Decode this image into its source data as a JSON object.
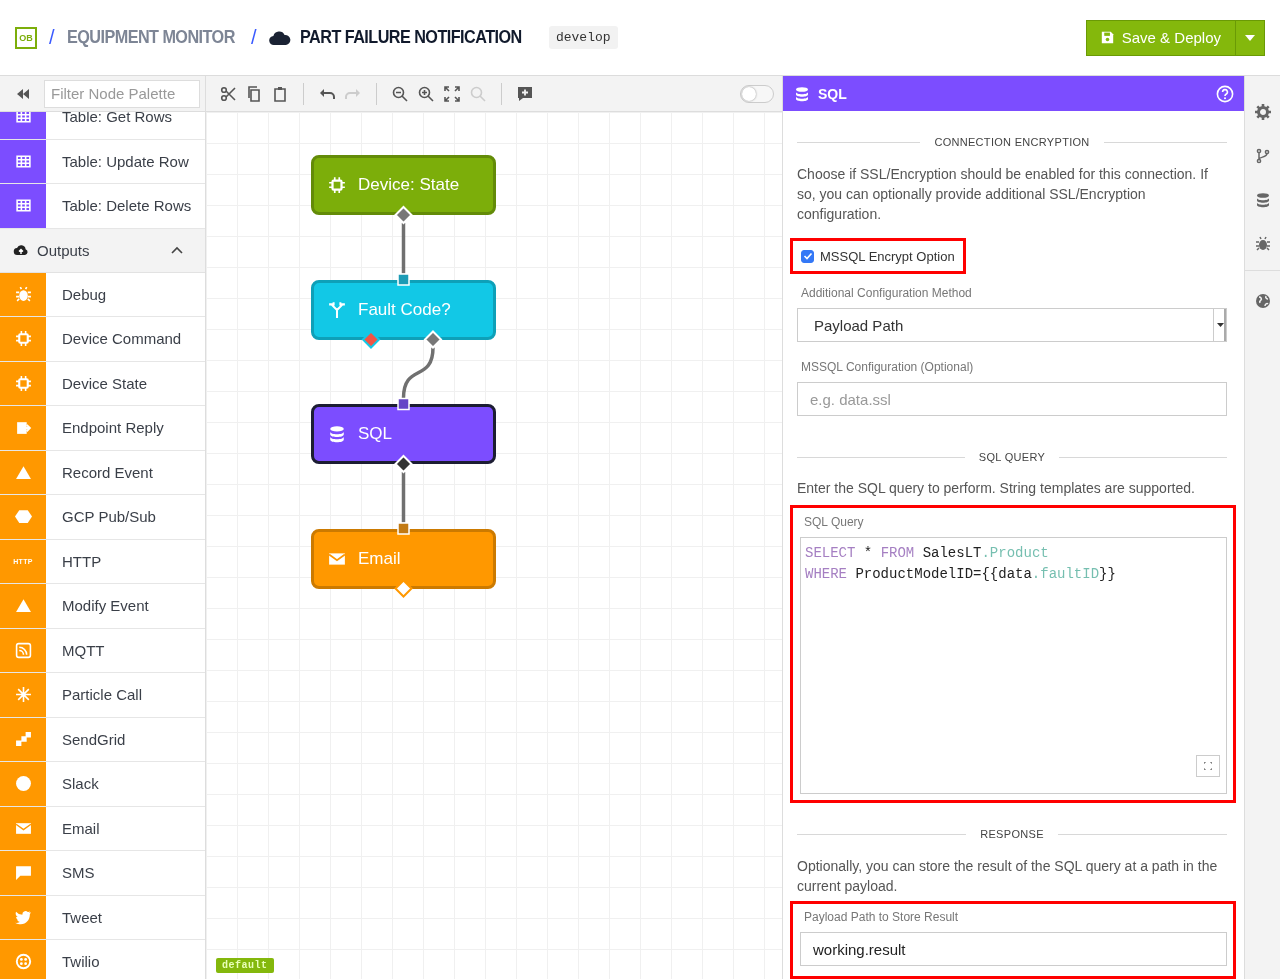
{
  "header": {
    "logo": "OB",
    "breadcrumb": [
      {
        "separator": "/",
        "text": "EQUIPMENT MONITOR",
        "current": false
      },
      {
        "separator": "/",
        "text": "PART FAILURE NOTIFICATION",
        "current": true
      }
    ],
    "version_tag": "develop",
    "save_button": "Save & Deploy"
  },
  "palette": {
    "filter_placeholder": "Filter Node Palette",
    "items": [
      {
        "kind": "node",
        "label": "Table: Get Rows",
        "color": "#7c4dff"
      },
      {
        "kind": "node",
        "label": "Table: Update Row",
        "color": "#7c4dff"
      },
      {
        "kind": "node",
        "label": "Table: Delete Rows",
        "color": "#7c4dff"
      },
      {
        "kind": "category",
        "label": "Outputs",
        "expanded": true
      },
      {
        "kind": "node",
        "label": "Debug",
        "color": "#ff9800"
      },
      {
        "kind": "node",
        "label": "Device Command",
        "color": "#ff9800"
      },
      {
        "kind": "node",
        "label": "Device State",
        "color": "#ff9800"
      },
      {
        "kind": "node",
        "label": "Endpoint Reply",
        "color": "#ff9800"
      },
      {
        "kind": "node",
        "label": "Record Event",
        "color": "#ff9800"
      },
      {
        "kind": "node",
        "label": "GCP Pub/Sub",
        "color": "#ff9800"
      },
      {
        "kind": "node",
        "label": "HTTP",
        "color": "#ff9800",
        "icon_text": "HTTP"
      },
      {
        "kind": "node",
        "label": "Modify Event",
        "color": "#ff9800"
      },
      {
        "kind": "node",
        "label": "MQTT",
        "color": "#ff9800"
      },
      {
        "kind": "node",
        "label": "Particle Call",
        "color": "#ff9800"
      },
      {
        "kind": "node",
        "label": "SendGrid",
        "color": "#ff9800"
      },
      {
        "kind": "node",
        "label": "Slack",
        "color": "#ff9800"
      },
      {
        "kind": "node",
        "label": "Email",
        "color": "#ff9800"
      },
      {
        "kind": "node",
        "label": "SMS",
        "color": "#ff9800"
      },
      {
        "kind": "node",
        "label": "Tweet",
        "color": "#ff9800"
      },
      {
        "kind": "node",
        "label": "Twilio",
        "color": "#ff9800"
      }
    ]
  },
  "canvas": {
    "toolbar": [
      {
        "disabled": false
      },
      {
        "disabled": false
      },
      {
        "disabled": false
      },
      {
        "disabled": false
      },
      {
        "disabled": true
      },
      {
        "disabled": false
      },
      {
        "disabled": false
      },
      {
        "disabled": false
      },
      {
        "disabled": true
      },
      {
        "disabled": false
      }
    ],
    "toggle_on": false,
    "nodes": [
      {
        "label": "Device: State",
        "color": "#7cae0a",
        "selected": false,
        "outputs": [
          {
            "color": "#777777",
            "connected": true
          }
        ]
      },
      {
        "label": "Fault Code?",
        "color": "#12c8e6",
        "selected": false,
        "outputs": [
          {
            "color": "#f05545",
            "connected": false
          },
          {
            "color": "#777777",
            "connected": true
          }
        ]
      },
      {
        "label": "SQL",
        "color": "#7c4dff",
        "selected": true,
        "outputs": [
          {
            "color": "#333333",
            "connected": true
          }
        ]
      },
      {
        "label": "Email",
        "color": "#ff9800",
        "selected": false,
        "outputs": [
          {
            "color": "#ffffff",
            "connected": false
          }
        ]
      }
    ],
    "badge": "default"
  },
  "panel": {
    "title": "SQL",
    "sections": [
      {
        "heading": "CONNECTION ENCRYPTION",
        "description": "Choose if SSL/Encryption should be enabled for this connection. If so, you can optionally provide additional SSL/Encryption configuration.",
        "fields": [
          {
            "kind": "checkbox",
            "label": "MSSQL Encrypt Option",
            "checked": true,
            "highlighted": true
          },
          {
            "kind": "select",
            "label": "Additional Configuration Method",
            "value": "Payload Path",
            "highlighted": false
          },
          {
            "kind": "text",
            "label": "MSSQL Configuration (Optional)",
            "placeholder": "e.g. data.ssl",
            "highlighted": false
          }
        ]
      },
      {
        "heading": "SQL QUERY",
        "description": "Enter the SQL query to perform. String templates are supported.",
        "fields": [
          {
            "kind": "code",
            "label": "SQL Query",
            "highlighted": true,
            "lines": [
              [
                {
                  "kind": "keyword",
                  "text": "SELECT"
                },
                {
                  "kind": "plain",
                  "text": " * "
                },
                {
                  "kind": "keyword",
                  "text": "FROM"
                },
                {
                  "kind": "plain",
                  "text": " SalesLT"
                },
                {
                  "kind": "property",
                  "text": ".Product"
                }
              ],
              [
                {
                  "kind": "keyword",
                  "text": "WHERE"
                },
                {
                  "kind": "plain",
                  "text": " ProductModelID={{data"
                },
                {
                  "kind": "property",
                  "text": ".faultID"
                },
                {
                  "kind": "plain",
                  "text": "}}"
                }
              ]
            ]
          }
        ]
      },
      {
        "heading": "RESPONSE",
        "description": "Optionally, you can store the result of the SQL query at a path in the current payload.",
        "fields": [
          {
            "kind": "text",
            "label": "Payload Path to Store Result",
            "value": "working.result",
            "highlighted": true
          }
        ]
      }
    ]
  }
}
